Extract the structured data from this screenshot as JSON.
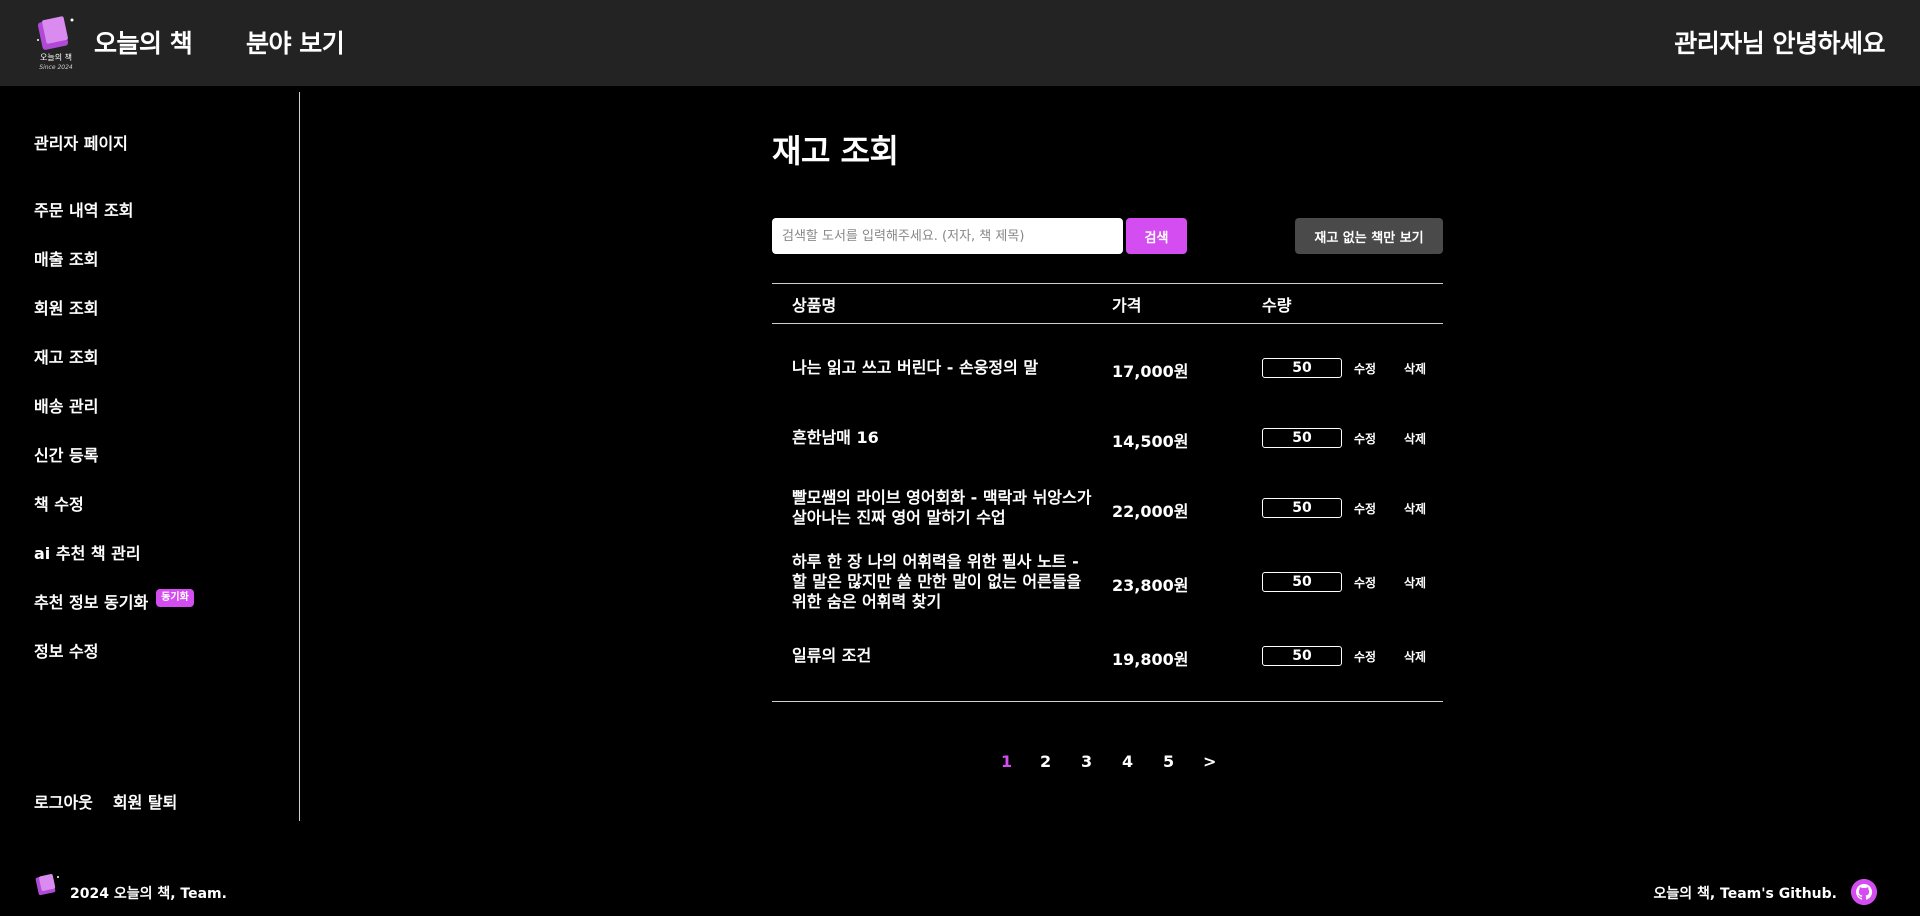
{
  "header": {
    "brand": "오늘의 책",
    "nav_genre": "분야 보기",
    "greeting": "관리자님 안녕하세요",
    "logo_text": "오늘의 책",
    "logo_since": "Since 2024"
  },
  "sidebar": {
    "title": "관리자 페이지",
    "items": [
      {
        "label": "주문 내역 조회"
      },
      {
        "label": "매출 조회"
      },
      {
        "label": "회원 조회"
      },
      {
        "label": "재고 조회"
      },
      {
        "label": "배송 관리"
      },
      {
        "label": "신간 등록"
      },
      {
        "label": "책 수정"
      },
      {
        "label": "ai 추천 책 관리"
      },
      {
        "label": "추천 정보 동기화",
        "badge": "동기화"
      },
      {
        "label": "정보 수정"
      }
    ],
    "logout": "로그아웃",
    "withdraw": "회원 탈퇴"
  },
  "main": {
    "title": "재고 조회",
    "search_placeholder": "검색할 도서를 입력해주세요. (저자, 책 제목)",
    "search_button": "검색",
    "filter_button": "재고 없는 책만 보기",
    "columns": {
      "title": "상품명",
      "price": "가격",
      "qty": "수량"
    },
    "edit_label": "수정",
    "delete_label": "삭제",
    "rows": [
      {
        "title": "나는 읽고 쓰고 버린다 - 손웅정의 말",
        "price": "17,000원",
        "qty": "50"
      },
      {
        "title": "흔한남매 16",
        "price": "14,500원",
        "qty": "50"
      },
      {
        "title": "빨모쌤의 라이브 영어회화 - 맥락과 뉘앙스가 살아나는 진짜 영어 말하기 수업",
        "price": "22,000원",
        "qty": "50"
      },
      {
        "title": "하루 한 장 나의 어휘력을 위한 필사 노트 - 할 말은 많지만 쓸 만한 말이 없는 어른들을 위한 숨은 어휘력 찾기",
        "price": "23,800원",
        "qty": "50"
      },
      {
        "title": "일류의 조건",
        "price": "19,800원",
        "qty": "50"
      }
    ],
    "pages": [
      "1",
      "2",
      "3",
      "4",
      "5"
    ],
    "current_page": "1",
    "next": ">"
  },
  "footer": {
    "left": "2024 오늘의 책, Team.",
    "right": "오늘의 책, Team's Github."
  },
  "colors": {
    "accent": "#d44df0",
    "header_bg": "#232323",
    "page_bg": "#000000"
  }
}
